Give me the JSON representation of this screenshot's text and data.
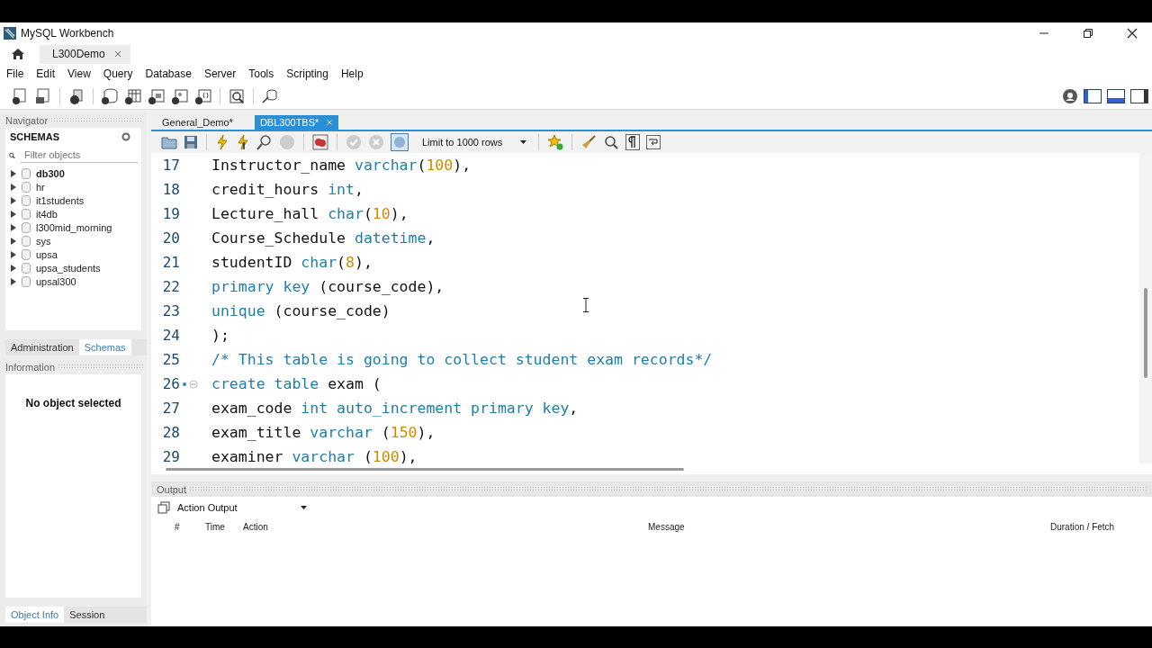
{
  "window": {
    "title": "MySQL Workbench"
  },
  "connection_tabs": [
    {
      "label": "L300Demo",
      "selected": true
    }
  ],
  "menu": [
    "File",
    "Edit",
    "View",
    "Query",
    "Database",
    "Server",
    "Tools",
    "Scripting",
    "Help"
  ],
  "navigator": {
    "title": "Navigator",
    "schemas_title": "SCHEMAS",
    "filter": {
      "placeholder": "Filter objects"
    },
    "schemas": [
      {
        "name": "db300",
        "default": true
      },
      {
        "name": "hr",
        "default": false
      },
      {
        "name": "it1students",
        "default": false
      },
      {
        "name": "it4db",
        "default": false
      },
      {
        "name": "l300mid_morning",
        "default": false
      },
      {
        "name": "sys",
        "default": false
      },
      {
        "name": "upsa",
        "default": false
      },
      {
        "name": "upsa_students",
        "default": false
      },
      {
        "name": "upsal300",
        "default": false
      }
    ],
    "tabs": [
      {
        "label": "Administration",
        "selected": false
      },
      {
        "label": "Schemas",
        "selected": true
      }
    ],
    "information_title": "Information",
    "information_text": "No object selected",
    "bottom_tabs": [
      {
        "label": "Object Info",
        "selected": true
      },
      {
        "label": "Session",
        "selected": false
      }
    ]
  },
  "editor_tabs": [
    {
      "label": "General_Demo*",
      "selected": false
    },
    {
      "label": "DBL300TBS*",
      "selected": true
    }
  ],
  "limit": "Limit to 1000 rows",
  "code": [
    {
      "number": "17",
      "marker": false,
      "tokens": [
        {
          "kind": "plain",
          "text": "Instructor_name "
        },
        {
          "kind": "keyword",
          "text": "varchar"
        },
        {
          "kind": "plain",
          "text": "("
        },
        {
          "kind": "number",
          "text": "100"
        },
        {
          "kind": "plain",
          "text": "),"
        }
      ]
    },
    {
      "number": "18",
      "marker": false,
      "tokens": [
        {
          "kind": "plain",
          "text": "credit_hours "
        },
        {
          "kind": "keyword",
          "text": "int"
        },
        {
          "kind": "plain",
          "text": ","
        }
      ]
    },
    {
      "number": "19",
      "marker": false,
      "tokens": [
        {
          "kind": "plain",
          "text": "Lecture_hall "
        },
        {
          "kind": "keyword",
          "text": "char"
        },
        {
          "kind": "plain",
          "text": "("
        },
        {
          "kind": "number",
          "text": "10"
        },
        {
          "kind": "plain",
          "text": "),"
        }
      ]
    },
    {
      "number": "20",
      "marker": false,
      "tokens": [
        {
          "kind": "plain",
          "text": "Course_Schedule "
        },
        {
          "kind": "keyword",
          "text": "datetime"
        },
        {
          "kind": "plain",
          "text": ","
        }
      ]
    },
    {
      "number": "21",
      "marker": false,
      "tokens": [
        {
          "kind": "plain",
          "text": "studentID "
        },
        {
          "kind": "keyword",
          "text": "char"
        },
        {
          "kind": "plain",
          "text": "("
        },
        {
          "kind": "number",
          "text": "8"
        },
        {
          "kind": "plain",
          "text": "),"
        }
      ]
    },
    {
      "number": "22",
      "marker": false,
      "tokens": [
        {
          "kind": "keyword",
          "text": "primary key"
        },
        {
          "kind": "plain",
          "text": " (course_code),"
        }
      ]
    },
    {
      "number": "23",
      "marker": false,
      "tokens": [
        {
          "kind": "keyword",
          "text": "unique"
        },
        {
          "kind": "plain",
          "text": " (course_code)"
        }
      ]
    },
    {
      "number": "24",
      "marker": false,
      "tokens": [
        {
          "kind": "plain",
          "text": ");"
        }
      ]
    },
    {
      "number": "25",
      "marker": false,
      "tokens": [
        {
          "kind": "comment",
          "text": "/* This table is going to collect student exam records*/"
        }
      ]
    },
    {
      "number": "26",
      "marker": true,
      "tokens": [
        {
          "kind": "keyword",
          "text": "create table"
        },
        {
          "kind": "plain",
          "text": " exam ("
        }
      ]
    },
    {
      "number": "27",
      "marker": false,
      "tokens": [
        {
          "kind": "plain",
          "text": "exam_code "
        },
        {
          "kind": "keyword",
          "text": "int auto_increment primary key"
        },
        {
          "kind": "plain",
          "text": ","
        }
      ]
    },
    {
      "number": "28",
      "marker": false,
      "tokens": [
        {
          "kind": "plain",
          "text": "exam_title "
        },
        {
          "kind": "keyword",
          "text": "varchar"
        },
        {
          "kind": "plain",
          "text": " ("
        },
        {
          "kind": "number",
          "text": "150"
        },
        {
          "kind": "plain",
          "text": "),"
        }
      ]
    },
    {
      "number": "29",
      "marker": false,
      "tokens": [
        {
          "kind": "plain",
          "text": "examiner "
        },
        {
          "kind": "keyword",
          "text": "varchar"
        },
        {
          "kind": "plain",
          "text": " ("
        },
        {
          "kind": "number",
          "text": "100"
        },
        {
          "kind": "plain",
          "text": "),"
        }
      ]
    }
  ],
  "output": {
    "title": "Output",
    "selector": "Action Output",
    "columns": [
      "#",
      "Time",
      "Action",
      "Message",
      "Duration / Fetch"
    ]
  }
}
